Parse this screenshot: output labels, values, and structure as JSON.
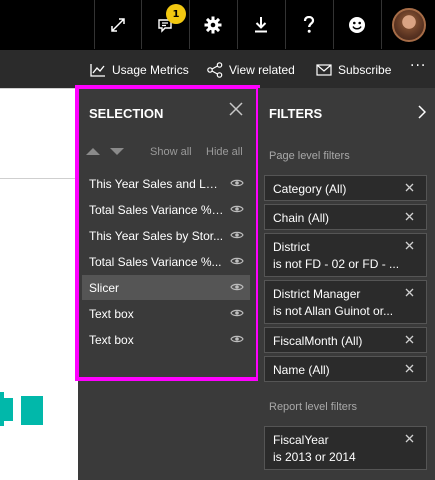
{
  "topbar": {
    "notification_count": "1",
    "icons": [
      "expand-icon",
      "comment-icon",
      "gear-icon",
      "download-icon",
      "help-icon",
      "smiley-icon"
    ]
  },
  "actionbar": {
    "usage_metrics": "Usage Metrics",
    "view_related": "View related",
    "subscribe": "Subscribe",
    "more": "···"
  },
  "selection": {
    "title": "SELECTION",
    "show_all": "Show all",
    "hide_all": "Hide all",
    "items": [
      {
        "label": "This Year Sales and Las..."
      },
      {
        "label": "Total Sales Variance %,..."
      },
      {
        "label": "This Year Sales by Stor..."
      },
      {
        "label": "Total Sales Variance %..."
      },
      {
        "label": "Slicer"
      },
      {
        "label": "Text box"
      },
      {
        "label": "Text box"
      }
    ]
  },
  "filters": {
    "title": "FILTERS",
    "page_level_label": "Page level filters",
    "report_level_label": "Report level filters",
    "page_filters": [
      {
        "name": "Category (All)",
        "sub": ""
      },
      {
        "name": "Chain  (All)",
        "sub": ""
      },
      {
        "name": "District",
        "sub": "is not FD - 02 or FD - ..."
      },
      {
        "name": "District Manager",
        "sub": "is not Allan Guinot or..."
      },
      {
        "name": "FiscalMonth  (All)",
        "sub": ""
      },
      {
        "name": "Name  (All)",
        "sub": ""
      }
    ],
    "report_filters": [
      {
        "name": "FiscalYear",
        "sub": "is 2013 or 2014"
      }
    ]
  },
  "colors": {
    "highlight": "#ff00ff",
    "badge": "#f2c811",
    "teal": "#01b8aa"
  }
}
